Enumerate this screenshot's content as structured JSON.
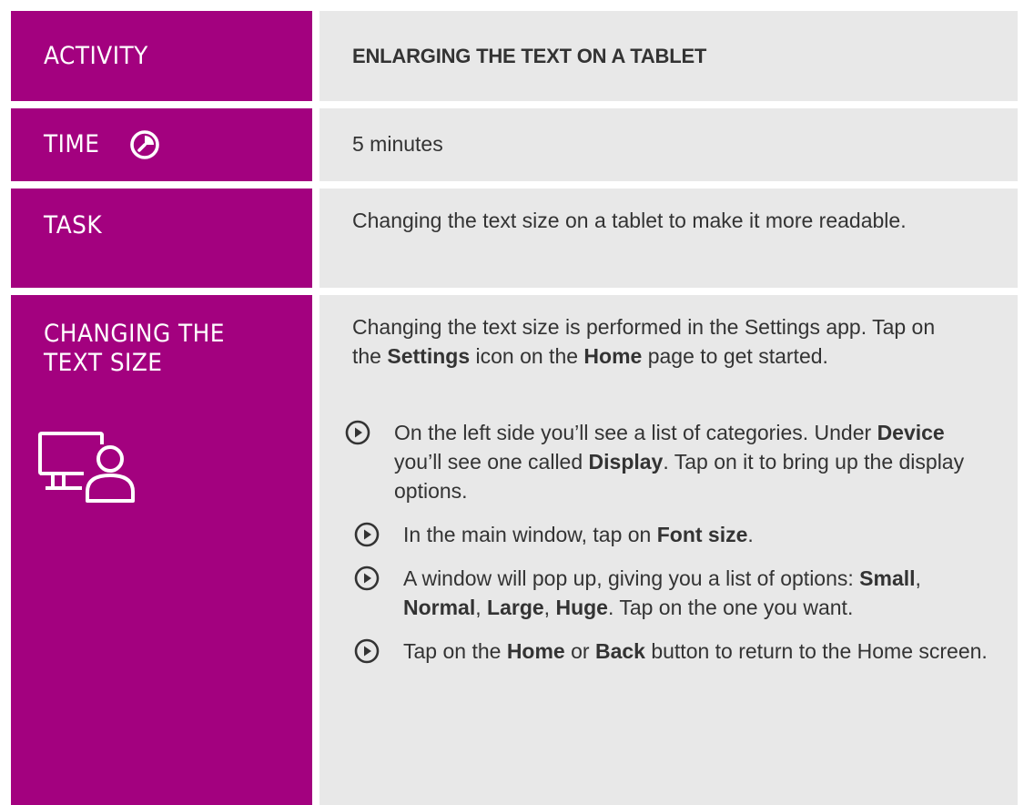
{
  "activity": {
    "label": "ACTIVITY",
    "title": "ENLARGING THE TEXT ON A TABLET"
  },
  "time": {
    "label": "TIME",
    "icon": "clock-icon",
    "value": "5 minutes"
  },
  "task": {
    "label": "TASK",
    "value": "Changing the text size on a tablet to make it more readable."
  },
  "changing": {
    "label_line1": "CHANGING THE",
    "label_line2": "TEXT SIZE",
    "icon": "computer-user-icon",
    "intro_a": "Changing the text size is performed in the Settings app. Tap on the ",
    "intro_settings": "Settings",
    "intro_b": " icon on the ",
    "intro_home": "Home",
    "intro_c": " page to get started.",
    "steps": [
      {
        "a": "On the left side you’ll see a list of categories. Under ",
        "b1": "Device",
        "c": " you’ll see one called ",
        "b2": "Display",
        "d": ". Tap on it to bring up the display options."
      },
      {
        "a": "In the main window, tap on ",
        "b1": "Font size",
        "c": "."
      },
      {
        "a": "A window will pop up, giving you a list of options: ",
        "b1": "Small",
        "s1": ", ",
        "b2": "Normal",
        "s2": ", ",
        "b3": "Large",
        "s3": ", ",
        "b4": "Huge",
        "c": ". Tap on the one you want."
      },
      {
        "a": "Tap on the ",
        "b1": "Home",
        "c": " or ",
        "b2": "Back",
        "d": " button to return to the Home screen."
      }
    ],
    "step_icon": "play-circle-icon"
  },
  "colors": {
    "label_bg": "#a3017f",
    "content_bg": "#e8e8e8",
    "text": "#333333"
  }
}
